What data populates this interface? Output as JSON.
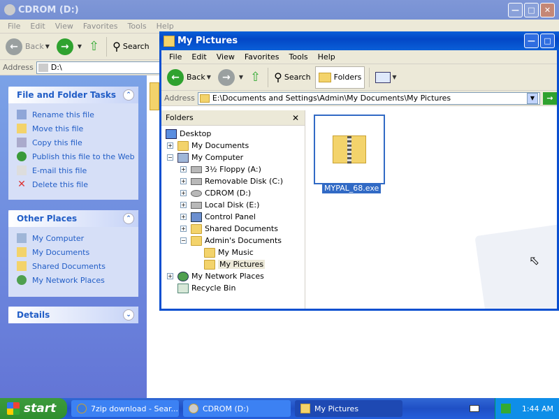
{
  "back_window": {
    "title": "CDROM (D:)",
    "menu": [
      "File",
      "Edit",
      "View",
      "Favorites",
      "Tools",
      "Help"
    ],
    "toolbar": {
      "back": "Back",
      "search": "Search"
    },
    "address_label": "Address",
    "address_value": "D:\\"
  },
  "task_pane": {
    "file_tasks": {
      "title": "File and Folder Tasks",
      "items": [
        "Rename this file",
        "Move this file",
        "Copy this file",
        "Publish this file to the Web",
        "E-mail this file",
        "Delete this file"
      ]
    },
    "other_places": {
      "title": "Other Places",
      "items": [
        "My Computer",
        "My Documents",
        "Shared Documents",
        "My Network Places"
      ]
    },
    "details": {
      "title": "Details"
    }
  },
  "front_window": {
    "title": "My Pictures",
    "menu": [
      "File",
      "Edit",
      "View",
      "Favorites",
      "Tools",
      "Help"
    ],
    "toolbar": {
      "back": "Back",
      "search": "Search",
      "folders": "Folders"
    },
    "address_label": "Address",
    "address_value": "E:\\Documents and Settings\\Admin\\My Documents\\My Pictures",
    "folders_pane_title": "Folders",
    "tree": [
      "Desktop",
      "My Documents",
      "My Computer",
      "3½ Floppy (A:)",
      "Removable Disk (C:)",
      "CDROM (D:)",
      "Local Disk (E:)",
      "Control Panel",
      "Shared Documents",
      "Admin's Documents",
      "My Music",
      "My Pictures",
      "My Network Places",
      "Recycle Bin"
    ],
    "file": {
      "name": "MYPAL_68.exe"
    }
  },
  "taskbar": {
    "start": "start",
    "buttons": [
      "7zip download - Sear...",
      "CDROM (D:)",
      "My Pictures"
    ],
    "clock": "1:44 AM"
  }
}
